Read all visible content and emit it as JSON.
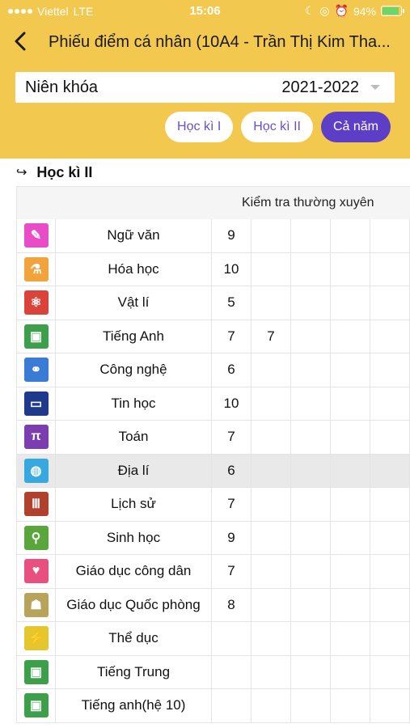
{
  "status": {
    "carrier": "Viettel",
    "network": "LTE",
    "time": "15:06",
    "battery": "94%"
  },
  "nav": {
    "title": "Phiếu điểm cá nhân (10A4 - Trần Thị Kim Tha..."
  },
  "year": {
    "label": "Niên khóa",
    "value": "2021-2022"
  },
  "tabs": [
    "Học kì I",
    "Học kì II",
    "Cả năm"
  ],
  "section": {
    "title": "Học kì II"
  },
  "table": {
    "header": "Kiểm tra thường xuyên",
    "rows": [
      {
        "name": "Ngữ văn",
        "icon": "pen-paper-icon",
        "color": "#e84cc6",
        "scores": [
          "9",
          "",
          "",
          "",
          ""
        ]
      },
      {
        "name": "Hóa học",
        "icon": "flask-icon",
        "color": "#f2a33b",
        "scores": [
          "10",
          "",
          "",
          "",
          ""
        ]
      },
      {
        "name": "Vật lí",
        "icon": "atom-icon",
        "color": "#d9433a",
        "scores": [
          "5",
          "",
          "",
          "",
          ""
        ]
      },
      {
        "name": "Tiếng Anh",
        "icon": "book-abc-icon",
        "color": "#3ca04a",
        "scores": [
          "7",
          "7",
          "",
          "",
          ""
        ]
      },
      {
        "name": "Công nghệ",
        "icon": "molecule-icon",
        "color": "#3a7bd5",
        "scores": [
          "6",
          "",
          "",
          "",
          ""
        ]
      },
      {
        "name": "Tin học",
        "icon": "monitor-icon",
        "color": "#1f3a8c",
        "scores": [
          "10",
          "",
          "",
          "",
          ""
        ]
      },
      {
        "name": "Toán",
        "icon": "pi-icon",
        "color": "#7b3db0",
        "scores": [
          "7",
          "",
          "",
          "",
          ""
        ]
      },
      {
        "name": "Địa lí",
        "icon": "globe-icon",
        "color": "#37a8e0",
        "scores": [
          "6",
          "",
          "",
          "",
          ""
        ]
      },
      {
        "name": "Lịch sử",
        "icon": "column-icon",
        "color": "#b0412d",
        "scores": [
          "7",
          "",
          "",
          "",
          ""
        ]
      },
      {
        "name": "Sinh học",
        "icon": "microscope-icon",
        "color": "#5aa63c",
        "scores": [
          "9",
          "",
          "",
          "",
          ""
        ]
      },
      {
        "name": "Giáo dục công dân",
        "icon": "people-heart-icon",
        "color": "#e8507f",
        "scores": [
          "7",
          "",
          "",
          "",
          ""
        ]
      },
      {
        "name": "Giáo dục Quốc phòng",
        "icon": "soldier-icon",
        "color": "#b7a35a",
        "scores": [
          "8",
          "",
          "",
          "",
          ""
        ]
      },
      {
        "name": "Thể dục",
        "icon": "runner-icon",
        "color": "#e6c62e",
        "scores": [
          "",
          "",
          "",
          "",
          ""
        ]
      },
      {
        "name": "Tiếng Trung",
        "icon": "book-abc-icon",
        "color": "#3ca04a",
        "scores": [
          "",
          "",
          "",
          "",
          ""
        ]
      },
      {
        "name": "Tiếng anh(hệ 10)",
        "icon": "book-abc-icon",
        "color": "#3ca04a",
        "scores": [
          "",
          "",
          "",
          "",
          ""
        ]
      }
    ]
  }
}
